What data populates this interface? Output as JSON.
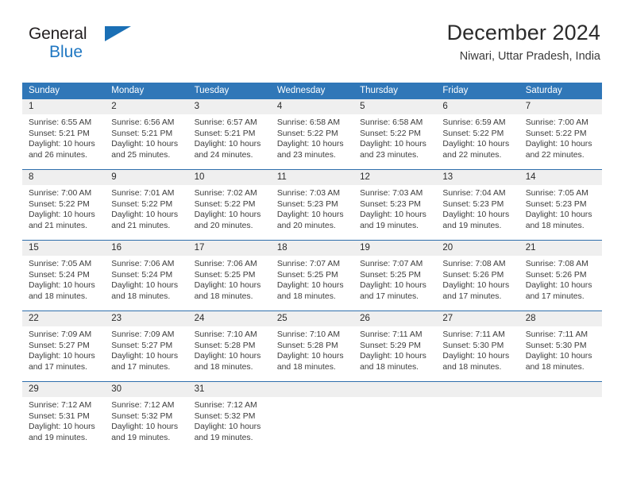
{
  "brand": {
    "name_part1": "General",
    "name_part2": "Blue",
    "logo_icon": "triangle-icon",
    "colors": {
      "general": "#231f20",
      "blue": "#1f77c2",
      "triangle": "#1a6fb5"
    }
  },
  "header": {
    "title": "December 2024",
    "subtitle": "Niwari, Uttar Pradesh, India"
  },
  "theme": {
    "header_bar": "#3077b8",
    "date_band": "#efefef",
    "text": "#2b2b2b"
  },
  "weekdays": [
    "Sunday",
    "Monday",
    "Tuesday",
    "Wednesday",
    "Thursday",
    "Friday",
    "Saturday"
  ],
  "weeks": [
    [
      {
        "day": "1",
        "sunrise": "Sunrise: 6:55 AM",
        "sunset": "Sunset: 5:21 PM",
        "daylight_line1": "Daylight: 10 hours",
        "daylight_line2": "and 26 minutes."
      },
      {
        "day": "2",
        "sunrise": "Sunrise: 6:56 AM",
        "sunset": "Sunset: 5:21 PM",
        "daylight_line1": "Daylight: 10 hours",
        "daylight_line2": "and 25 minutes."
      },
      {
        "day": "3",
        "sunrise": "Sunrise: 6:57 AM",
        "sunset": "Sunset: 5:21 PM",
        "daylight_line1": "Daylight: 10 hours",
        "daylight_line2": "and 24 minutes."
      },
      {
        "day": "4",
        "sunrise": "Sunrise: 6:58 AM",
        "sunset": "Sunset: 5:22 PM",
        "daylight_line1": "Daylight: 10 hours",
        "daylight_line2": "and 23 minutes."
      },
      {
        "day": "5",
        "sunrise": "Sunrise: 6:58 AM",
        "sunset": "Sunset: 5:22 PM",
        "daylight_line1": "Daylight: 10 hours",
        "daylight_line2": "and 23 minutes."
      },
      {
        "day": "6",
        "sunrise": "Sunrise: 6:59 AM",
        "sunset": "Sunset: 5:22 PM",
        "daylight_line1": "Daylight: 10 hours",
        "daylight_line2": "and 22 minutes."
      },
      {
        "day": "7",
        "sunrise": "Sunrise: 7:00 AM",
        "sunset": "Sunset: 5:22 PM",
        "daylight_line1": "Daylight: 10 hours",
        "daylight_line2": "and 22 minutes."
      }
    ],
    [
      {
        "day": "8",
        "sunrise": "Sunrise: 7:00 AM",
        "sunset": "Sunset: 5:22 PM",
        "daylight_line1": "Daylight: 10 hours",
        "daylight_line2": "and 21 minutes."
      },
      {
        "day": "9",
        "sunrise": "Sunrise: 7:01 AM",
        "sunset": "Sunset: 5:22 PM",
        "daylight_line1": "Daylight: 10 hours",
        "daylight_line2": "and 21 minutes."
      },
      {
        "day": "10",
        "sunrise": "Sunrise: 7:02 AM",
        "sunset": "Sunset: 5:22 PM",
        "daylight_line1": "Daylight: 10 hours",
        "daylight_line2": "and 20 minutes."
      },
      {
        "day": "11",
        "sunrise": "Sunrise: 7:03 AM",
        "sunset": "Sunset: 5:23 PM",
        "daylight_line1": "Daylight: 10 hours",
        "daylight_line2": "and 20 minutes."
      },
      {
        "day": "12",
        "sunrise": "Sunrise: 7:03 AM",
        "sunset": "Sunset: 5:23 PM",
        "daylight_line1": "Daylight: 10 hours",
        "daylight_line2": "and 19 minutes."
      },
      {
        "day": "13",
        "sunrise": "Sunrise: 7:04 AM",
        "sunset": "Sunset: 5:23 PM",
        "daylight_line1": "Daylight: 10 hours",
        "daylight_line2": "and 19 minutes."
      },
      {
        "day": "14",
        "sunrise": "Sunrise: 7:05 AM",
        "sunset": "Sunset: 5:23 PM",
        "daylight_line1": "Daylight: 10 hours",
        "daylight_line2": "and 18 minutes."
      }
    ],
    [
      {
        "day": "15",
        "sunrise": "Sunrise: 7:05 AM",
        "sunset": "Sunset: 5:24 PM",
        "daylight_line1": "Daylight: 10 hours",
        "daylight_line2": "and 18 minutes."
      },
      {
        "day": "16",
        "sunrise": "Sunrise: 7:06 AM",
        "sunset": "Sunset: 5:24 PM",
        "daylight_line1": "Daylight: 10 hours",
        "daylight_line2": "and 18 minutes."
      },
      {
        "day": "17",
        "sunrise": "Sunrise: 7:06 AM",
        "sunset": "Sunset: 5:25 PM",
        "daylight_line1": "Daylight: 10 hours",
        "daylight_line2": "and 18 minutes."
      },
      {
        "day": "18",
        "sunrise": "Sunrise: 7:07 AM",
        "sunset": "Sunset: 5:25 PM",
        "daylight_line1": "Daylight: 10 hours",
        "daylight_line2": "and 18 minutes."
      },
      {
        "day": "19",
        "sunrise": "Sunrise: 7:07 AM",
        "sunset": "Sunset: 5:25 PM",
        "daylight_line1": "Daylight: 10 hours",
        "daylight_line2": "and 17 minutes."
      },
      {
        "day": "20",
        "sunrise": "Sunrise: 7:08 AM",
        "sunset": "Sunset: 5:26 PM",
        "daylight_line1": "Daylight: 10 hours",
        "daylight_line2": "and 17 minutes."
      },
      {
        "day": "21",
        "sunrise": "Sunrise: 7:08 AM",
        "sunset": "Sunset: 5:26 PM",
        "daylight_line1": "Daylight: 10 hours",
        "daylight_line2": "and 17 minutes."
      }
    ],
    [
      {
        "day": "22",
        "sunrise": "Sunrise: 7:09 AM",
        "sunset": "Sunset: 5:27 PM",
        "daylight_line1": "Daylight: 10 hours",
        "daylight_line2": "and 17 minutes."
      },
      {
        "day": "23",
        "sunrise": "Sunrise: 7:09 AM",
        "sunset": "Sunset: 5:27 PM",
        "daylight_line1": "Daylight: 10 hours",
        "daylight_line2": "and 17 minutes."
      },
      {
        "day": "24",
        "sunrise": "Sunrise: 7:10 AM",
        "sunset": "Sunset: 5:28 PM",
        "daylight_line1": "Daylight: 10 hours",
        "daylight_line2": "and 18 minutes."
      },
      {
        "day": "25",
        "sunrise": "Sunrise: 7:10 AM",
        "sunset": "Sunset: 5:28 PM",
        "daylight_line1": "Daylight: 10 hours",
        "daylight_line2": "and 18 minutes."
      },
      {
        "day": "26",
        "sunrise": "Sunrise: 7:11 AM",
        "sunset": "Sunset: 5:29 PM",
        "daylight_line1": "Daylight: 10 hours",
        "daylight_line2": "and 18 minutes."
      },
      {
        "day": "27",
        "sunrise": "Sunrise: 7:11 AM",
        "sunset": "Sunset: 5:30 PM",
        "daylight_line1": "Daylight: 10 hours",
        "daylight_line2": "and 18 minutes."
      },
      {
        "day": "28",
        "sunrise": "Sunrise: 7:11 AM",
        "sunset": "Sunset: 5:30 PM",
        "daylight_line1": "Daylight: 10 hours",
        "daylight_line2": "and 18 minutes."
      }
    ],
    [
      {
        "day": "29",
        "sunrise": "Sunrise: 7:12 AM",
        "sunset": "Sunset: 5:31 PM",
        "daylight_line1": "Daylight: 10 hours",
        "daylight_line2": "and 19 minutes."
      },
      {
        "day": "30",
        "sunrise": "Sunrise: 7:12 AM",
        "sunset": "Sunset: 5:32 PM",
        "daylight_line1": "Daylight: 10 hours",
        "daylight_line2": "and 19 minutes."
      },
      {
        "day": "31",
        "sunrise": "Sunrise: 7:12 AM",
        "sunset": "Sunset: 5:32 PM",
        "daylight_line1": "Daylight: 10 hours",
        "daylight_line2": "and 19 minutes."
      },
      {
        "day": "",
        "sunrise": "",
        "sunset": "",
        "daylight_line1": "",
        "daylight_line2": ""
      },
      {
        "day": "",
        "sunrise": "",
        "sunset": "",
        "daylight_line1": "",
        "daylight_line2": ""
      },
      {
        "day": "",
        "sunrise": "",
        "sunset": "",
        "daylight_line1": "",
        "daylight_line2": ""
      },
      {
        "day": "",
        "sunrise": "",
        "sunset": "",
        "daylight_line1": "",
        "daylight_line2": ""
      }
    ]
  ]
}
